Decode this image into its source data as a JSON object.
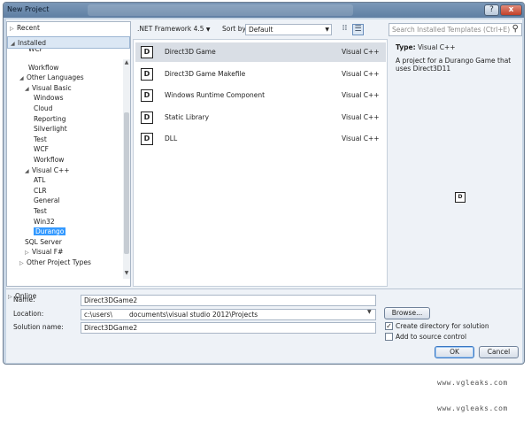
{
  "window": {
    "title": "New Project",
    "help": "?",
    "close": "x"
  },
  "tree": {
    "recent": "Recent",
    "installed": "Installed",
    "online": "Online",
    "items": [
      {
        "label": "WCF",
        "indent": 2
      },
      {
        "label": "Workflow",
        "indent": 2
      },
      {
        "label": "Other Languages",
        "indent": 1,
        "expand": "◢"
      },
      {
        "label": "Visual Basic",
        "indent": 1.6,
        "expand": "◢"
      },
      {
        "label": "Windows",
        "indent": 2.6
      },
      {
        "label": "Cloud",
        "indent": 2.6
      },
      {
        "label": "Reporting",
        "indent": 2.6
      },
      {
        "label": "Silverlight",
        "indent": 2.6
      },
      {
        "label": "Test",
        "indent": 2.6
      },
      {
        "label": "WCF",
        "indent": 2.6
      },
      {
        "label": "Workflow",
        "indent": 2.6
      },
      {
        "label": "Visual C++",
        "indent": 1.6,
        "expand": "◢"
      },
      {
        "label": "ATL",
        "indent": 2.6
      },
      {
        "label": "CLR",
        "indent": 2.6
      },
      {
        "label": "General",
        "indent": 2.6
      },
      {
        "label": "Test",
        "indent": 2.6
      },
      {
        "label": "Win32",
        "indent": 2.6
      },
      {
        "label": "Durango",
        "indent": 2.6,
        "selected": true
      },
      {
        "label": "SQL Server",
        "indent": 1.6
      },
      {
        "label": "Visual F#",
        "indent": 1.6,
        "expand": "▷"
      },
      {
        "label": "Other Project Types",
        "indent": 1,
        "expand": "▷"
      }
    ]
  },
  "toolbar": {
    "framework": ".NET Framework 4.5",
    "sort_label": "Sort by:",
    "sort_value": "Default",
    "search_placeholder": "Search Installed Templates (Ctrl+E)"
  },
  "templates": [
    {
      "name": "Direct3D Game",
      "lang": "Visual C++",
      "selected": true
    },
    {
      "name": "Direct3D Game Makefile",
      "lang": "Visual C++"
    },
    {
      "name": "Windows Runtime Component",
      "lang": "Visual C++"
    },
    {
      "name": "Static Library",
      "lang": "Visual C++"
    },
    {
      "name": "DLL",
      "lang": "Visual C++"
    }
  ],
  "details": {
    "type_label": "Type:",
    "type_value": "Visual C++",
    "description": "A project for a Durango Game that uses Direct3D11"
  },
  "form": {
    "name_label": "Name:",
    "name_value": "Direct3DGame2",
    "location_label": "Location:",
    "location_value": "c:\\users\\        documents\\visual studio 2012\\Projects",
    "solution_label": "Solution name:",
    "solution_value": "Direct3DGame2",
    "browse": "Browse...",
    "create_dir": "Create directory for solution",
    "create_dir_checked": true,
    "source_control": "Add to source control",
    "source_control_checked": false,
    "ok": "OK",
    "cancel": "Cancel"
  },
  "watermark": "www.vgleaks.com"
}
